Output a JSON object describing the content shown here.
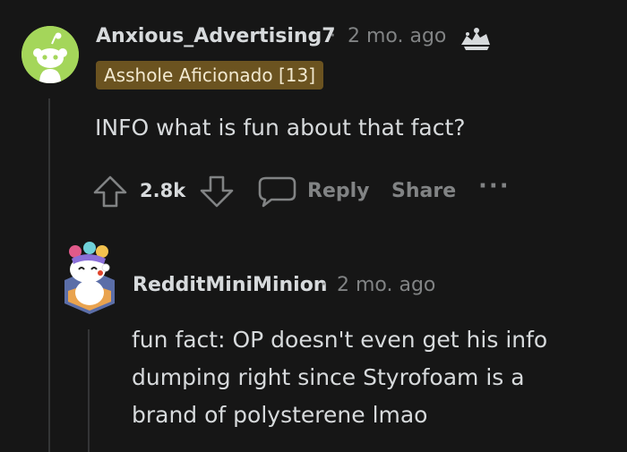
{
  "comments": [
    {
      "username": "Anxious_Advertising7",
      "separator": "·",
      "age": "2 mo. ago",
      "flair": "Asshole Aficionado [13]",
      "body": "INFO what is fun about that fact?",
      "score": "2.8k",
      "actions": {
        "reply": "Reply",
        "share": "Share",
        "more": "···"
      }
    },
    {
      "username": "RedditMiniMinion",
      "separator": "·",
      "age": "2 mo. ago",
      "body_lines": [
        "fun fact: OP doesn't even get his info",
        "dumping right since Styrofoam is a",
        "brand of polysterene lmao"
      ]
    }
  ],
  "icons": {
    "avatar_1": "snoo-avatar-green",
    "award": "award-icon",
    "upvote": "upvote-arrow-icon",
    "downvote": "downvote-arrow-icon",
    "reply": "comment-bubble-icon",
    "avatar_2": "snoo-avatar-custom"
  },
  "colors": {
    "background": "#161616",
    "flair_background": "#6b5320",
    "avatar_green": "#a4d65a",
    "muted_text": "#818384",
    "primary_text": "#d7dadc"
  }
}
